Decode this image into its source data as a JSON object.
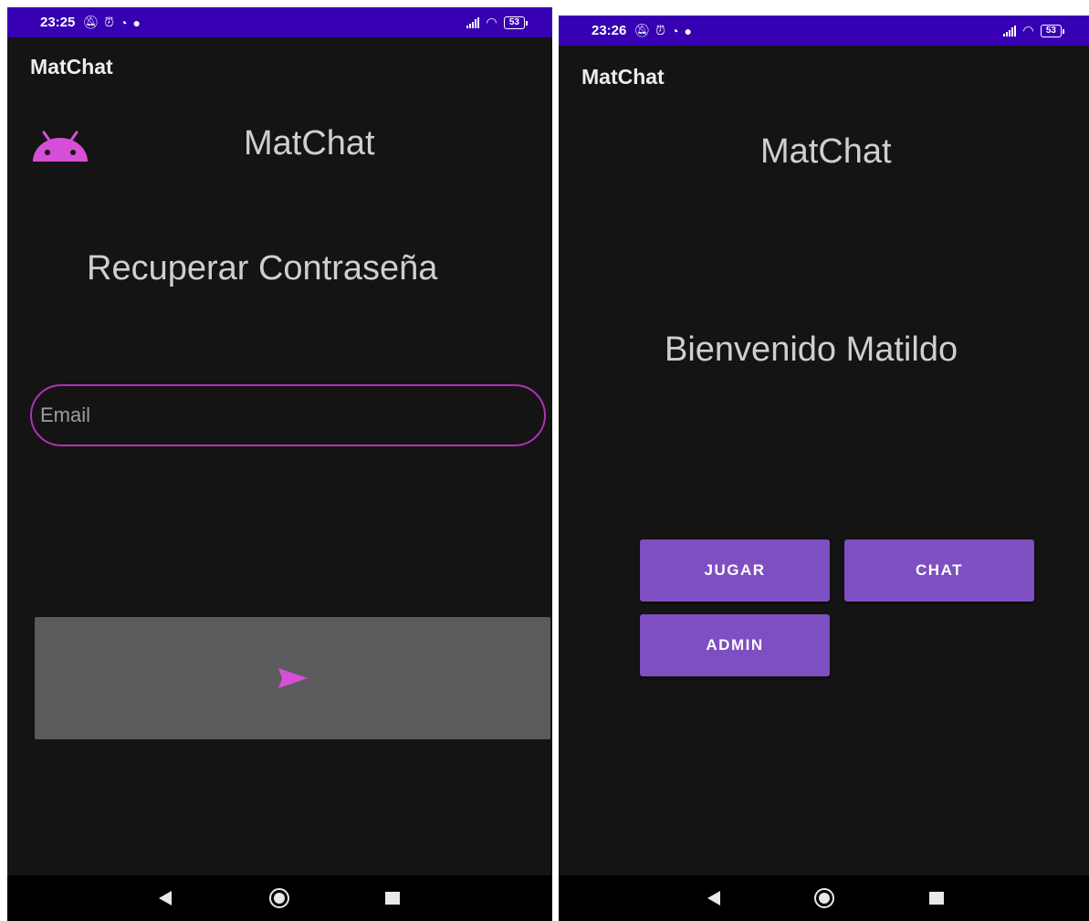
{
  "left_screen": {
    "status": {
      "time": "23:25",
      "battery": "53"
    },
    "app_title": "MatChat",
    "header_title": "MatChat",
    "page_title": "Recuperar Contraseña",
    "email_placeholder": "Email",
    "send_icon": "send-icon",
    "logo_icon": "android-icon"
  },
  "right_screen": {
    "status": {
      "time": "23:26",
      "battery": "53"
    },
    "app_title": "MatChat",
    "header_title": "MatChat",
    "welcome_text": "Bienvenido Matildo",
    "buttons": {
      "jugar": "JUGAR",
      "chat": "CHAT",
      "admin": "ADMIN"
    }
  },
  "colors": {
    "status_bar": "#3700b3",
    "background": "#141414",
    "accent_pink": "#d64fd8",
    "button_purple": "#7e4fc0",
    "send_button_gray": "#5b5b5d"
  }
}
